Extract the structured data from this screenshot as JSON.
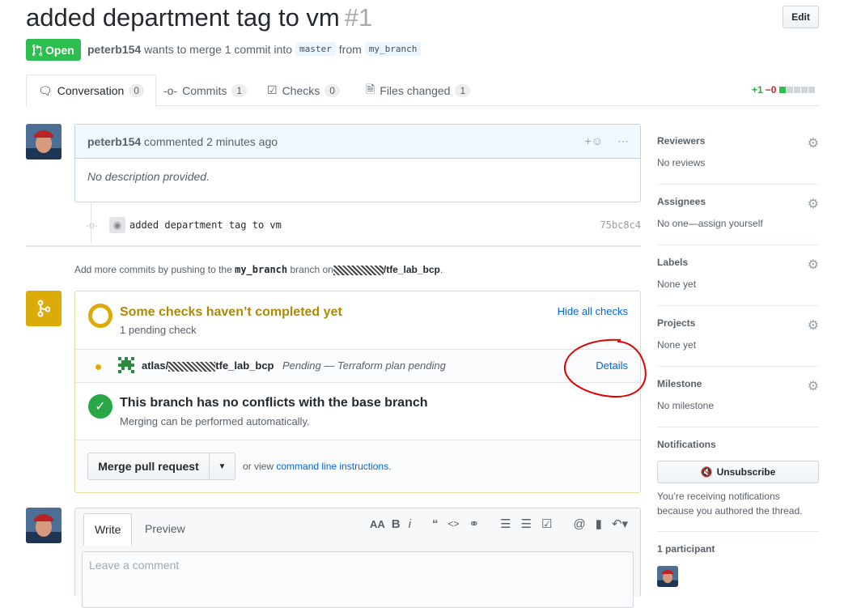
{
  "pr": {
    "title": "added department tag to vm",
    "number": "#1",
    "edit_label": "Edit",
    "state": "Open",
    "author": "peterb154",
    "merge_text": "wants to merge 1 commit into",
    "base_branch": "master",
    "from_text": "from",
    "head_branch": "my_branch"
  },
  "tabs": [
    {
      "label": "Conversation",
      "count": "0"
    },
    {
      "label": "Commits",
      "count": "1"
    },
    {
      "label": "Checks",
      "count": "0"
    },
    {
      "label": "Files changed",
      "count": "1"
    }
  ],
  "diffstat": {
    "added": "+1",
    "removed": "−0"
  },
  "comment": {
    "author": "peterb154",
    "action": "commented 2 minutes ago",
    "body": "No description provided."
  },
  "commit": {
    "message": "added department tag to vm",
    "sha": "75bc8c4"
  },
  "push_note": {
    "prefix": "Add more commits by pushing to the",
    "branch": "my_branch",
    "middle": "branch on",
    "repo": "/tfe_lab_bcp",
    "suffix": "."
  },
  "checks": {
    "title": "Some checks haven’t completed yet",
    "subtitle": "1 pending check",
    "hide_label": "Hide all checks",
    "check_name_prefix": "atlas/",
    "check_name_suffix": "tfe_lab_bcp",
    "check_status": "Pending — Terraform plan pending",
    "details_label": "Details"
  },
  "conflicts": {
    "title": "This branch has no conflicts with the base branch",
    "subtitle": "Merging can be performed automatically."
  },
  "merge": {
    "button": "Merge pull request",
    "or_view": "or view",
    "cli_link": "command line instructions",
    "period": "."
  },
  "sidebar": {
    "sections": [
      {
        "heading": "Reviewers",
        "value": "No reviews"
      },
      {
        "heading": "Assignees",
        "value": "No one—assign yourself"
      },
      {
        "heading": "Labels",
        "value": "None yet"
      },
      {
        "heading": "Projects",
        "value": "None yet"
      },
      {
        "heading": "Milestone",
        "value": "No milestone"
      }
    ],
    "notifications_heading": "Notifications",
    "unsubscribe_label": "Unsubscribe",
    "notifications_reason": "You’re receiving notifications because you authored the thread.",
    "participants": "1 participant"
  },
  "editor": {
    "write_tab": "Write",
    "preview_tab": "Preview",
    "placeholder": "Leave a comment"
  },
  "colors": {
    "open_green": "#2cbe4e",
    "pending_yellow": "#dbab09",
    "link_blue": "#0366d6",
    "annotation_red": "#e00000"
  }
}
